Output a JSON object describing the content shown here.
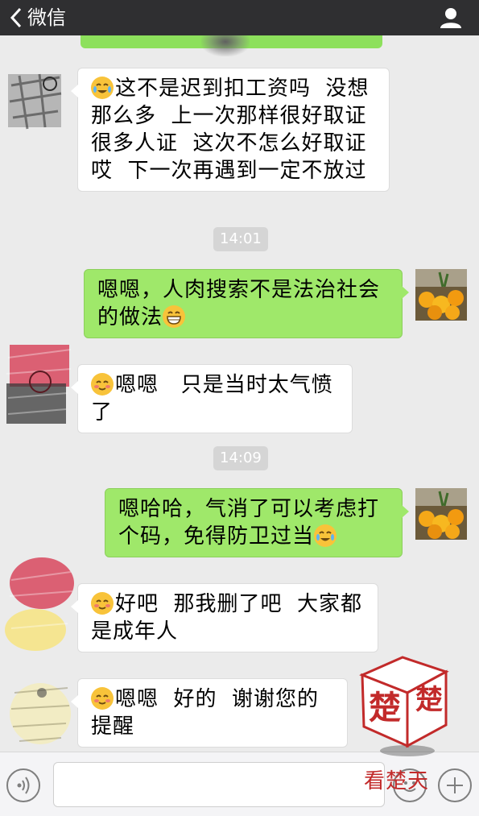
{
  "header": {
    "back_label": "微信",
    "back_icon": "chevron-left-icon",
    "profile_icon": "person-icon"
  },
  "messages": [
    {
      "side": "left",
      "emoji": "crying-laughing",
      "text": "这不是迟到扣工资吗  没想那么多  上一次那样很好取证  很多人证  这次不怎么好取证  哎  下一次再遇到一定不放过"
    },
    {
      "side": "right",
      "emoji": "grinning",
      "text": "嗯嗯，人肉搜索不是法治社会的做法"
    },
    {
      "side": "left",
      "emoji": "blushing",
      "text": "嗯嗯   只是当时太气愤了"
    },
    {
      "side": "right",
      "emoji": "crying-laughing",
      "text": "嗯哈哈，气消了可以考虑打个码，免得防卫过当"
    },
    {
      "side": "left",
      "emoji": "blushing",
      "text": "好吧  那我删了吧  大家都是成年人"
    },
    {
      "side": "left",
      "emoji": "blushing",
      "text": "嗯嗯  好的  谢谢您的提醒"
    }
  ],
  "timestamps": [
    "14:01",
    "14:09"
  ],
  "input": {
    "value": "",
    "voice_icon": "voice-icon",
    "emoji_icon": "emoji-icon",
    "plus_icon": "plus-icon"
  },
  "watermark": {
    "stamp_text": "楚楚",
    "label": "看楚天"
  },
  "colors": {
    "topbar": "#2f2f31",
    "background": "#ebebeb",
    "bubble_green": "#9fe86a",
    "bubble_white": "#ffffff",
    "watermark_red": "#c22a2a"
  }
}
